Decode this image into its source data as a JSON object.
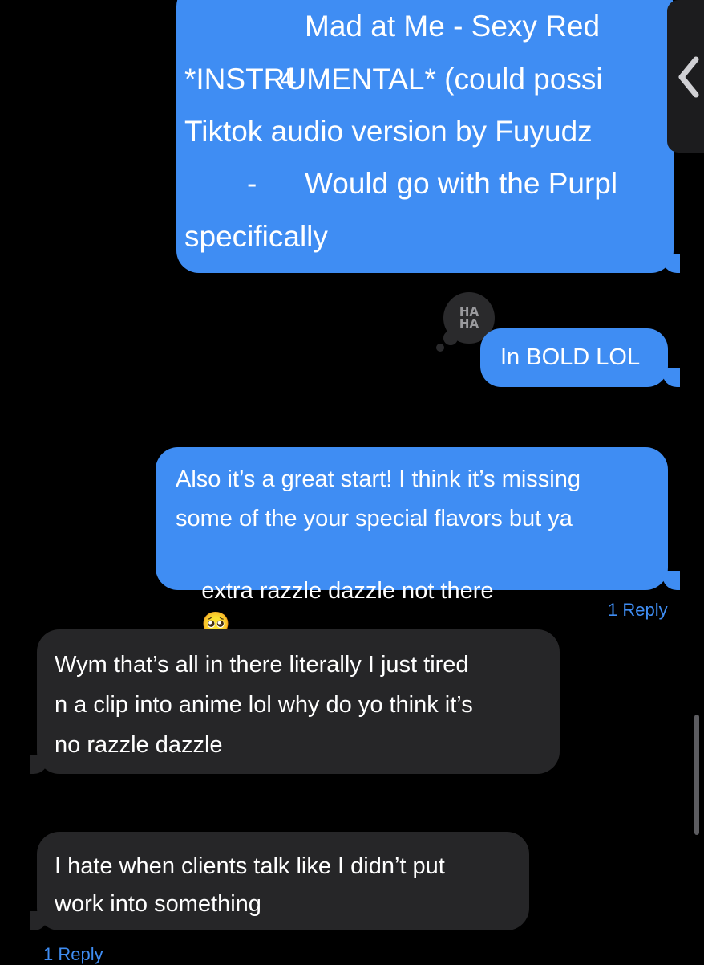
{
  "messages": {
    "top_list": {
      "line1_number": "4.",
      "line1_text": "Mad at Me - Sexy Red",
      "line2": "*INSTRUMENTAL* (could possi",
      "line3": "Tiktok audio version by Fuyudz",
      "line4_bullet": "-",
      "line4_text": "Would go with the Purpl",
      "line5": "specifically"
    },
    "tapback_line1": "HA",
    "tapback_line2": "HA",
    "bold_msg": "In BOLD LOL",
    "feedback_msg_line1": "Also it’s a great start! I think it’s missing",
    "feedback_msg_line2": "some of the your special flavors but ya",
    "feedback_msg_line3": "extra razzle dazzle not there",
    "feedback_emoji": "🥺",
    "feedback_reply": "1 Reply",
    "wym_msg_line1": "Wym that’s all in there literally I just tired",
    "wym_msg_line2": "n a clip into anime lol why do yo think it’s",
    "wym_msg_line3": "no razzle dazzle",
    "hate_msg_line1": "I hate when clients talk like I didn’t put",
    "hate_msg_line2": "work into something",
    "hate_reply": "1 Reply"
  },
  "side_tab_icon": "chevron-left-icon",
  "colors": {
    "outgoing": "#3f8df3",
    "incoming": "#262628",
    "background": "#000000"
  }
}
